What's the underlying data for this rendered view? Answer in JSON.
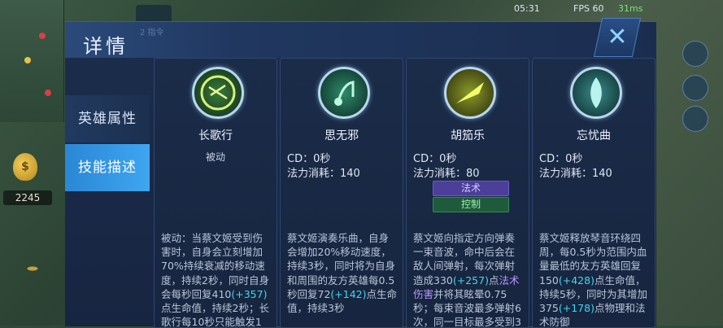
{
  "hud": {
    "gold": "2245",
    "gold_symbol": "$",
    "time": "05:31",
    "fps": "FPS 60",
    "network": "31ms",
    "header_faint": "2 指令"
  },
  "dialog": {
    "title": "详情",
    "close_symbol": "✕",
    "tabs": [
      {
        "label": "英雄属性",
        "active": false
      },
      {
        "label": "技能描述",
        "active": true
      }
    ]
  },
  "skills": [
    {
      "name": "长歌行",
      "type": "被动",
      "icon": "long-song-icon",
      "desc_html": "被动：当蔡文姬受到伤害时，自身会立刻增加70%持续衰减的移动速度，持续2秒，同时自身会每秒回复410<span class='hl-g'>(+357)</span>点生命值，持续2秒；长歌行每10秒只能触发1"
    },
    {
      "name": "思无邪",
      "cd": "CD：0秒",
      "cost": "法力消耗：140",
      "icon": "carefree-note-icon",
      "desc_html": "蔡文姬演奏乐曲，自身会增加20%移动速度，持续3秒，同时将为自身和周围的友方英雄每0.5秒回复72<span class='hl-g'>(+142)</span>点生命值，持续3秒"
    },
    {
      "name": "胡笳乐",
      "cd": "CD：0秒",
      "cost": "法力消耗：80",
      "tags": [
        "法术",
        "控制"
      ],
      "icon": "sound-wave-icon",
      "desc_html": "蔡文姬向指定方向弹奏一束音波，命中后会在敌人间弹射，每次弹射造成330<span class='hl-g'>(+257)</span>点<span class='hl-p'>法术伤害</span>并将其眩晕0.75秒；每束音波最多弹射6次，同一目标最多受到3次"
    },
    {
      "name": "忘忧曲",
      "cd": "CD：0秒",
      "cost": "法力消耗：140",
      "icon": "forget-sorrow-icon",
      "desc_html": "蔡文姬释放琴音环绕四周，每0.5秒为范围内血量最低的友方英雄回复150<span class='hl-g'>(+428)</span>点生命值，持续5秒，同时为其增加375<span class='hl-g'>(+178)</span>点物理和法术防御"
    }
  ],
  "colors": {
    "accent": "#3fa6f0",
    "highlight": "#43d6ef",
    "magic": "#b796ff"
  }
}
